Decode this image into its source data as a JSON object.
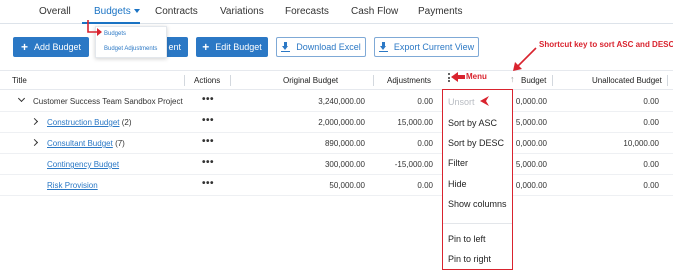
{
  "tabs": [
    {
      "label": "Overall"
    },
    {
      "label": "Budgets"
    },
    {
      "label": "Contracts"
    },
    {
      "label": "Variations"
    },
    {
      "label": "Forecasts"
    },
    {
      "label": "Cash Flow"
    },
    {
      "label": "Payments"
    }
  ],
  "submenu": {
    "items": [
      {
        "label": "Budgets"
      },
      {
        "label": "Budget Adjustments"
      }
    ]
  },
  "toolbar": {
    "add_budget": "Add Budget",
    "hidden_button_partial": "ent",
    "edit_budget": "Edit Budget",
    "download_excel": "Download Excel",
    "export_current_view": "Export Current View"
  },
  "table": {
    "columns": {
      "title": "Title",
      "actions": "Actions",
      "original_budget": "Original Budget",
      "adjustments": "Adjustments",
      "budget": "Budget",
      "unallocated_budget": "Unallocated Budget"
    },
    "rows": [
      {
        "title": "Customer Success Team Sandbox Project",
        "count": "",
        "actions": "•••",
        "original_budget": "3,240,000.00",
        "adjustments": "0.00",
        "budget": "0,000.00",
        "unallocated": "0.00"
      },
      {
        "title": "Construction Budget",
        "count": "(2)",
        "actions": "•••",
        "original_budget": "2,000,000.00",
        "adjustments": "15,000.00",
        "budget": "5,000.00",
        "unallocated": "0.00"
      },
      {
        "title": "Consultant Budget",
        "count": "(7)",
        "actions": "•••",
        "original_budget": "890,000.00",
        "adjustments": "0.00",
        "budget": "0,000.00",
        "unallocated": "10,000.00"
      },
      {
        "title": "Contingency Budget",
        "count": "",
        "actions": "•••",
        "original_budget": "300,000.00",
        "adjustments": "-15,000.00",
        "budget": "5,000.00",
        "unallocated": "0.00"
      },
      {
        "title": "Risk Provision",
        "count": "",
        "actions": "•••",
        "original_budget": "50,000.00",
        "adjustments": "0.00",
        "budget": "0,000.00",
        "unallocated": "0.00"
      }
    ]
  },
  "column_menu": {
    "items": [
      {
        "label": "Unsort",
        "disabled": true
      },
      {
        "label": "Sort by ASC"
      },
      {
        "label": "Sort by DESC"
      },
      {
        "label": "Filter"
      },
      {
        "label": "Hide"
      },
      {
        "label": "Show columns"
      },
      {
        "label": "Pin to left"
      },
      {
        "label": "Pin to right"
      }
    ]
  },
  "annotations": {
    "menu": "Menu",
    "shortcut": "Shortcut key to sort ASC and DESC"
  },
  "colors": {
    "accent": "#2b78c5",
    "annotation": "#d9232e"
  }
}
